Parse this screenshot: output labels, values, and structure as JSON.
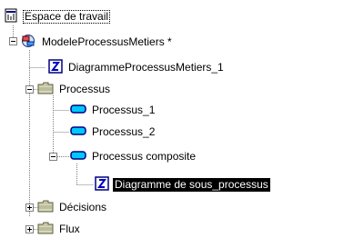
{
  "tree": {
    "workspace_label": "Espace de travail",
    "model_label": "ModeleProcessusMetiers *",
    "diagram_label": "DiagrammeProcessusMetiers_1",
    "processus_folder_label": "Processus",
    "processus_1_label": "Processus_1",
    "processus_2_label": "Processus_2",
    "processus_composite_label": "Processus composite",
    "sub_diagram_label": "Diagramme de sous_processus",
    "decisions_folder_label": "Décisions",
    "flux_folder_label": "Flux"
  },
  "colors": {
    "selection_bg": "#000000",
    "folder": "#c0c0a0",
    "process": "#00c8ff",
    "diagram_blue": "#0000c0"
  },
  "icons": {
    "workspace": "workspace-icon",
    "model": "model-icon",
    "diagram": "diagram-icon",
    "folder": "folder-icon",
    "process": "process-icon"
  }
}
